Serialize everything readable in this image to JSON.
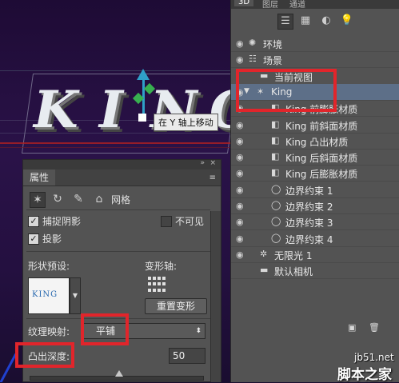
{
  "canvas": {
    "letters": [
      "K",
      "I",
      "N",
      "G"
    ],
    "tooltip": "在 Y 轴上移动"
  },
  "properties": {
    "tab": "属性",
    "collapse_icon": "»",
    "close_icon": "×",
    "mode_label": "网格",
    "capture_shadow": {
      "label": "捕捉阴影",
      "checked": true
    },
    "invisible": {
      "label": "不可见",
      "checked": false
    },
    "cast_shadow": {
      "label": "投影",
      "checked": true
    },
    "shape_preset_label": "形状预设:",
    "preview_text": "KING",
    "deform_axis_label": "变形轴:",
    "reset_deform_button": "重置变形",
    "texture_map_label": "纹理映射:",
    "texture_map_value": "平铺",
    "extrusion_depth_label": "凸出深度:",
    "extrusion_depth_value": "50",
    "slider_fraction": 0.52
  },
  "layers_panel": {
    "tabs": [
      "3D",
      "图层",
      "通道"
    ],
    "active_tab": "3D",
    "rows": [
      {
        "label": "环境",
        "icon": "environment-icon",
        "level": 0,
        "eye": true
      },
      {
        "label": "场景",
        "icon": "scene-icon",
        "level": 0,
        "eye": true
      },
      {
        "label": "当前视图",
        "icon": "camera-icon",
        "level": 1,
        "eye": false
      },
      {
        "label": "King",
        "icon": "mesh-icon",
        "level": 0,
        "eye": true,
        "selected": true,
        "expanded": true
      },
      {
        "label": "King 前膨胀材质",
        "icon": "material-icon",
        "level": 2,
        "eye": true
      },
      {
        "label": "King 前斜面材质",
        "icon": "material-icon",
        "level": 2,
        "eye": true
      },
      {
        "label": "King 凸出材质",
        "icon": "material-icon",
        "level": 2,
        "eye": true
      },
      {
        "label": "King 后斜面材质",
        "icon": "material-icon",
        "level": 2,
        "eye": true
      },
      {
        "label": "King 后膨胀材质",
        "icon": "material-icon",
        "level": 2,
        "eye": true
      },
      {
        "label": "边界约束 1",
        "icon": "constraint-icon",
        "level": 2,
        "eye": true
      },
      {
        "label": "边界约束 2",
        "icon": "constraint-icon",
        "level": 2,
        "eye": true
      },
      {
        "label": "边界约束 3",
        "icon": "constraint-icon",
        "level": 2,
        "eye": true
      },
      {
        "label": "边界约束 4",
        "icon": "constraint-icon",
        "level": 2,
        "eye": true
      },
      {
        "label": "无限光 1",
        "icon": "light-icon",
        "level": 1,
        "eye": true
      },
      {
        "label": "默认相机",
        "icon": "camera-icon",
        "level": 1,
        "eye": false
      }
    ]
  },
  "watermark": {
    "site": "jb51.net",
    "name": "脚本之家"
  },
  "colors": {
    "highlight": "#e1252b",
    "selected_row": "#5d6f88",
    "panel": "#535353",
    "scene_bg": "#1e0b35"
  }
}
